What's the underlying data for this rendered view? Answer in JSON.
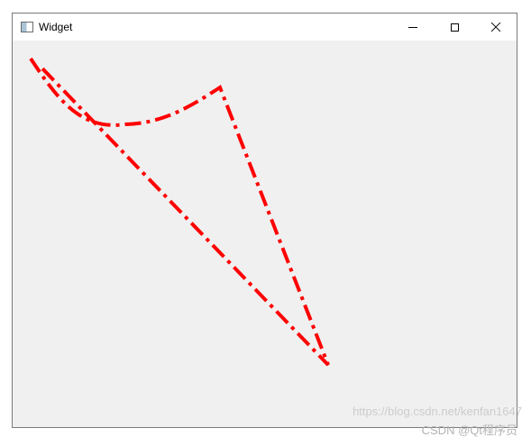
{
  "window": {
    "title": "Widget",
    "icon": "app-window-icon",
    "controls": {
      "minimize": "minimize-icon",
      "maximize": "maximize-icon",
      "close": "close-icon"
    }
  },
  "drawing": {
    "pen_color": "#ff0000",
    "style": "dash-dot"
  },
  "watermark": {
    "url": "https://blog.csdn.net/kenfan1647",
    "brand": "CSDN @Qt程序员"
  }
}
